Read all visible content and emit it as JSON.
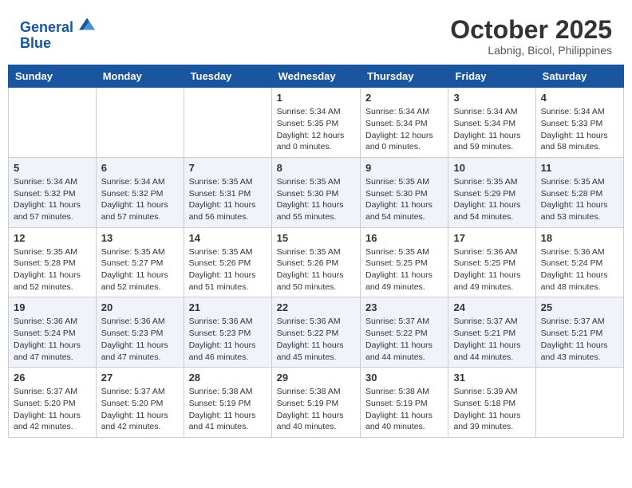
{
  "header": {
    "logo_line1": "General",
    "logo_line2": "Blue",
    "month_title": "October 2025",
    "location": "Labnig, Bicol, Philippines"
  },
  "days_of_week": [
    "Sunday",
    "Monday",
    "Tuesday",
    "Wednesday",
    "Thursday",
    "Friday",
    "Saturday"
  ],
  "weeks": [
    [
      {
        "day": "",
        "info": ""
      },
      {
        "day": "",
        "info": ""
      },
      {
        "day": "",
        "info": ""
      },
      {
        "day": "1",
        "info": "Sunrise: 5:34 AM\nSunset: 5:35 PM\nDaylight: 12 hours\nand 0 minutes."
      },
      {
        "day": "2",
        "info": "Sunrise: 5:34 AM\nSunset: 5:34 PM\nDaylight: 12 hours\nand 0 minutes."
      },
      {
        "day": "3",
        "info": "Sunrise: 5:34 AM\nSunset: 5:34 PM\nDaylight: 11 hours\nand 59 minutes."
      },
      {
        "day": "4",
        "info": "Sunrise: 5:34 AM\nSunset: 5:33 PM\nDaylight: 11 hours\nand 58 minutes."
      }
    ],
    [
      {
        "day": "5",
        "info": "Sunrise: 5:34 AM\nSunset: 5:32 PM\nDaylight: 11 hours\nand 57 minutes."
      },
      {
        "day": "6",
        "info": "Sunrise: 5:34 AM\nSunset: 5:32 PM\nDaylight: 11 hours\nand 57 minutes."
      },
      {
        "day": "7",
        "info": "Sunrise: 5:35 AM\nSunset: 5:31 PM\nDaylight: 11 hours\nand 56 minutes."
      },
      {
        "day": "8",
        "info": "Sunrise: 5:35 AM\nSunset: 5:30 PM\nDaylight: 11 hours\nand 55 minutes."
      },
      {
        "day": "9",
        "info": "Sunrise: 5:35 AM\nSunset: 5:30 PM\nDaylight: 11 hours\nand 54 minutes."
      },
      {
        "day": "10",
        "info": "Sunrise: 5:35 AM\nSunset: 5:29 PM\nDaylight: 11 hours\nand 54 minutes."
      },
      {
        "day": "11",
        "info": "Sunrise: 5:35 AM\nSunset: 5:28 PM\nDaylight: 11 hours\nand 53 minutes."
      }
    ],
    [
      {
        "day": "12",
        "info": "Sunrise: 5:35 AM\nSunset: 5:28 PM\nDaylight: 11 hours\nand 52 minutes."
      },
      {
        "day": "13",
        "info": "Sunrise: 5:35 AM\nSunset: 5:27 PM\nDaylight: 11 hours\nand 52 minutes."
      },
      {
        "day": "14",
        "info": "Sunrise: 5:35 AM\nSunset: 5:26 PM\nDaylight: 11 hours\nand 51 minutes."
      },
      {
        "day": "15",
        "info": "Sunrise: 5:35 AM\nSunset: 5:26 PM\nDaylight: 11 hours\nand 50 minutes."
      },
      {
        "day": "16",
        "info": "Sunrise: 5:35 AM\nSunset: 5:25 PM\nDaylight: 11 hours\nand 49 minutes."
      },
      {
        "day": "17",
        "info": "Sunrise: 5:36 AM\nSunset: 5:25 PM\nDaylight: 11 hours\nand 49 minutes."
      },
      {
        "day": "18",
        "info": "Sunrise: 5:36 AM\nSunset: 5:24 PM\nDaylight: 11 hours\nand 48 minutes."
      }
    ],
    [
      {
        "day": "19",
        "info": "Sunrise: 5:36 AM\nSunset: 5:24 PM\nDaylight: 11 hours\nand 47 minutes."
      },
      {
        "day": "20",
        "info": "Sunrise: 5:36 AM\nSunset: 5:23 PM\nDaylight: 11 hours\nand 47 minutes."
      },
      {
        "day": "21",
        "info": "Sunrise: 5:36 AM\nSunset: 5:23 PM\nDaylight: 11 hours\nand 46 minutes."
      },
      {
        "day": "22",
        "info": "Sunrise: 5:36 AM\nSunset: 5:22 PM\nDaylight: 11 hours\nand 45 minutes."
      },
      {
        "day": "23",
        "info": "Sunrise: 5:37 AM\nSunset: 5:22 PM\nDaylight: 11 hours\nand 44 minutes."
      },
      {
        "day": "24",
        "info": "Sunrise: 5:37 AM\nSunset: 5:21 PM\nDaylight: 11 hours\nand 44 minutes."
      },
      {
        "day": "25",
        "info": "Sunrise: 5:37 AM\nSunset: 5:21 PM\nDaylight: 11 hours\nand 43 minutes."
      }
    ],
    [
      {
        "day": "26",
        "info": "Sunrise: 5:37 AM\nSunset: 5:20 PM\nDaylight: 11 hours\nand 42 minutes."
      },
      {
        "day": "27",
        "info": "Sunrise: 5:37 AM\nSunset: 5:20 PM\nDaylight: 11 hours\nand 42 minutes."
      },
      {
        "day": "28",
        "info": "Sunrise: 5:38 AM\nSunset: 5:19 PM\nDaylight: 11 hours\nand 41 minutes."
      },
      {
        "day": "29",
        "info": "Sunrise: 5:38 AM\nSunset: 5:19 PM\nDaylight: 11 hours\nand 40 minutes."
      },
      {
        "day": "30",
        "info": "Sunrise: 5:38 AM\nSunset: 5:19 PM\nDaylight: 11 hours\nand 40 minutes."
      },
      {
        "day": "31",
        "info": "Sunrise: 5:39 AM\nSunset: 5:18 PM\nDaylight: 11 hours\nand 39 minutes."
      },
      {
        "day": "",
        "info": ""
      }
    ]
  ]
}
